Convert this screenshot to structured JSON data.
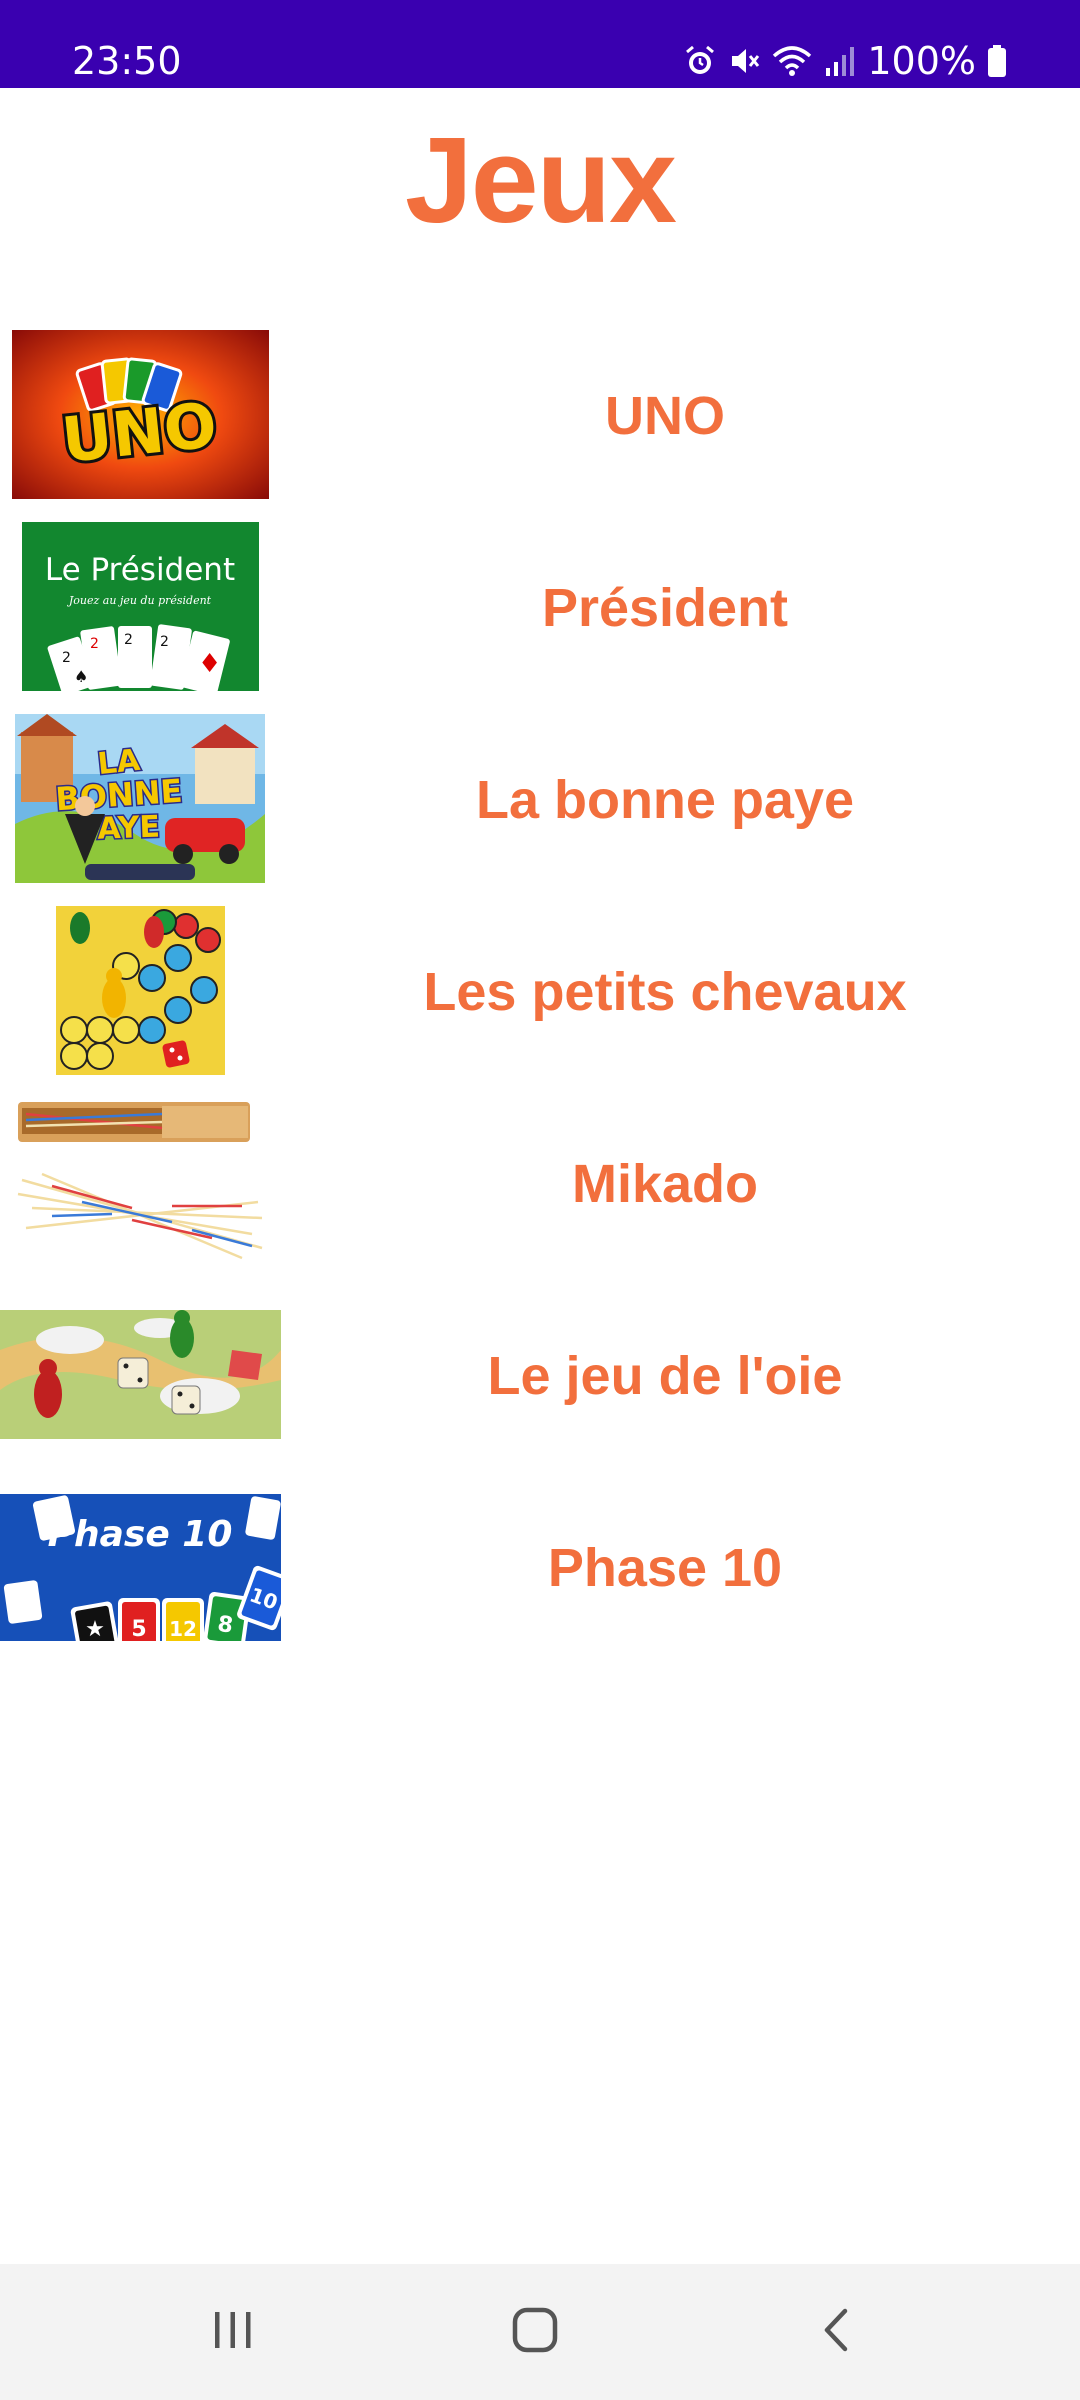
{
  "status_bar": {
    "time": "23:50",
    "battery_text": "100%",
    "icons": [
      "alarm-icon",
      "mute-icon",
      "wifi-icon",
      "signal-icon",
      "battery-icon"
    ],
    "background": "#3a00b0"
  },
  "header": {
    "title": "Jeux"
  },
  "games": [
    {
      "name": "UNO",
      "image": "uno-box-art"
    },
    {
      "name": "Président",
      "image": "le-president-cards"
    },
    {
      "name": "La bonne paye",
      "image": "la-bonne-paye-box"
    },
    {
      "name": "Les petits chevaux",
      "image": "petits-chevaux-board"
    },
    {
      "name": "Mikado",
      "image": "mikado-sticks"
    },
    {
      "name": "Le jeu de l'oie",
      "image": "jeu-de-loie-board"
    },
    {
      "name": "Phase 10",
      "image": "phase-10-box"
    }
  ],
  "thumbnail_text": {
    "uno": "UNO",
    "president_title": "Le Président",
    "president_subtitle": "Jouez au jeu du président",
    "bonne_paye_title": "LA BONNE PAYE",
    "phase10_title": "Phase 10"
  },
  "nav_bar": {
    "buttons": [
      "recents-button",
      "home-button",
      "back-button"
    ]
  },
  "colors": {
    "accent": "#f26f3d",
    "status_bar": "#3a00b0",
    "nav_bar": "#f3f3f3"
  }
}
